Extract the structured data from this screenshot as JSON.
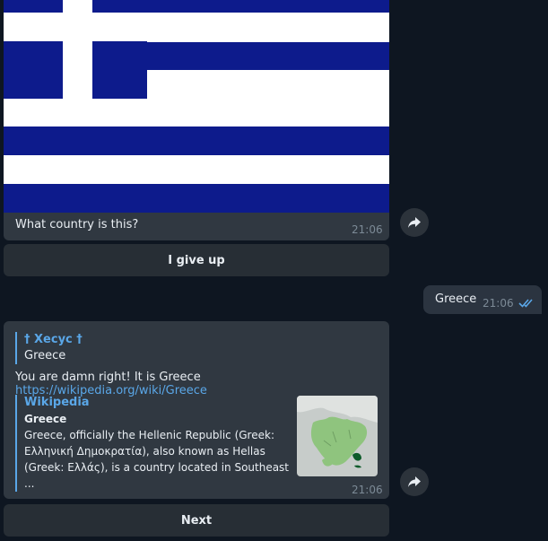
{
  "flag_message": {
    "caption": "What country is this?",
    "time": "21:06",
    "button": "I give up"
  },
  "outgoing_message": {
    "text": "Greece",
    "time": "21:06",
    "status": "read"
  },
  "reply_message": {
    "quoted_author": "† Хесус †",
    "quoted_text": "Greece",
    "text_prefix": "You are damn right! It is Greece ",
    "link": "https://wikipedia.org/wiki/Greece",
    "preview": {
      "site": "Wikipedia",
      "title": "Greece",
      "description": "Greece, officially the Hellenic Republic (Greek: Ελληνική Δημοκρατία), also known as Hellas (Greek: Ελλάς), is a country located in Southeast ..."
    },
    "time": "21:06",
    "button": "Next"
  },
  "icons": {
    "share": "share-icon",
    "read": "double-check-icon"
  },
  "colors": {
    "background": "#0e1621",
    "bubble": "#303841",
    "accent": "#5aa7e8",
    "flag_blue": "#0d1b8c"
  }
}
